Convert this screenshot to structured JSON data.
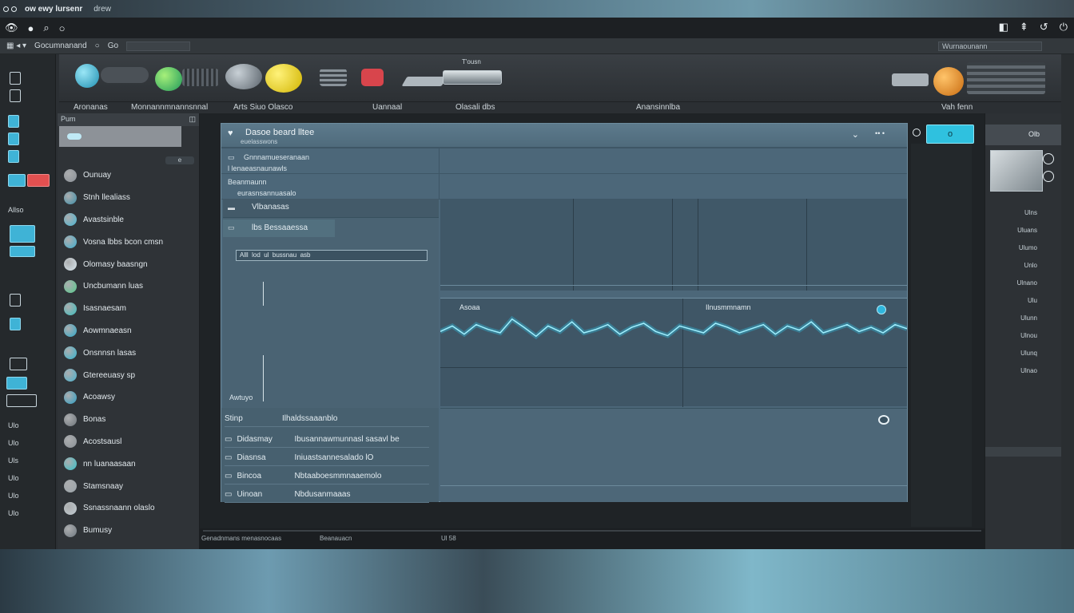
{
  "window": {
    "title": "ow ewy lursenr",
    "subtitle": "drew"
  },
  "iconbar": {
    "left_icons": [
      "eye-icon",
      "dot-icon",
      "search-icon",
      "circle-icon"
    ],
    "right_icons": [
      "lock-icon",
      "arrow-icon",
      "undo-icon",
      "power-icon"
    ]
  },
  "menu": {
    "items": [
      "Gocumnanand",
      "Go"
    ],
    "right_field": "Wurnaounann"
  },
  "ribbon_labels": [
    "Aronanas",
    "Monnannmnannsnnal",
    "Arts Siuo Olasco",
    "Uannaal",
    "Olasali dbs",
    "Anansinnlba",
    "Vah fenn"
  ],
  "ribbon": {
    "top_label": "T'ousn"
  },
  "leftstrip": {
    "labels": [
      "Allso",
      "Ulo",
      "Ulo",
      "Uls",
      "Ulo",
      "Ulo",
      "Ulo"
    ]
  },
  "layers": {
    "header": "Pum",
    "tab": "e",
    "items": [
      {
        "label": "Ounuay",
        "color": "#8a9097"
      },
      {
        "label": "Stnh llealiass",
        "color": "#3e8ea8"
      },
      {
        "label": "Avastsinble",
        "color": "#49b5d3"
      },
      {
        "label": "Vosna lbbs bcon cmsn",
        "color": "#3faed0"
      },
      {
        "label": "Olomasy baasngn",
        "color": "#d9e7ee"
      },
      {
        "label": "Uncbumann luas",
        "color": "#57c98c"
      },
      {
        "label": "Isasnaesam",
        "color": "#3dbdbd"
      },
      {
        "label": "Aowmnaeasn",
        "color": "#2fa9c9"
      },
      {
        "label": "Onsnnsn lasas",
        "color": "#35b4cf"
      },
      {
        "label": "Gtereeuasy sp",
        "color": "#4bb2cf"
      },
      {
        "label": "Acoawsy",
        "color": "#2f9ec3"
      },
      {
        "label": "Bonas",
        "color": "#6d747a"
      },
      {
        "label": "Acostsausl",
        "color": "#8a9096"
      },
      {
        "label": "nn luanaasaan",
        "color": "#38c0c8"
      },
      {
        "label": "Stamsnaay",
        "color": "#9aa3a9"
      },
      {
        "label": "Ssnassnaann olaslo",
        "color": "#c0cbd1"
      },
      {
        "label": "Bumusy",
        "color": "#6f7880"
      }
    ]
  },
  "canvas": {
    "header_title": "Dasoe beard lltee",
    "header_sub": "euelasswons",
    "row1_left": "Gnnnamueseranaan",
    "row1_sub": "l lenaeasnaunawls",
    "row2_left": "Beanmaunn",
    "row2_sub": "eurasnsannuasalo",
    "track_labels": [
      "Vlbanasas",
      "lbs Bessaaessa"
    ],
    "scrubber": "Alll  lod  ul  bussnau  asb",
    "side_caption": "Awtuyo",
    "wave_left": "Asoaa",
    "wave_right": "Ilnusmmnamn",
    "props_header_k": "Stinp",
    "props_header_v": "Ilhaldssaaanblo",
    "props": [
      {
        "k": "Didasmay",
        "v": "Ibusannawmunnasl sasavl be"
      },
      {
        "k": "Diasnsa",
        "v": "Iniuastsannesalado lO"
      },
      {
        "k": "Bincoa",
        "v": "Nbtaaboesmmnaaemolo"
      },
      {
        "k": "Uinoan",
        "v": "Nbdusanmaaas"
      }
    ],
    "action_button": "o"
  },
  "rightpanel": {
    "top_label": "Olb",
    "list": [
      "Ulns",
      "Uluans",
      "Ulumo",
      "Unlo",
      "Ulnano",
      "Ulu",
      "Ulunn",
      "Ulnou",
      "Ulunq",
      "Ulnao"
    ]
  },
  "status": {
    "left": "Genadnmans menasnocaas",
    "mid": "Beanauacn",
    "right": "Ul 58"
  },
  "wave_series": [
    0.52,
    0.6,
    0.48,
    0.62,
    0.55,
    0.5,
    0.7,
    0.58,
    0.45,
    0.6,
    0.52,
    0.66,
    0.5,
    0.55,
    0.62,
    0.48,
    0.58,
    0.64,
    0.52,
    0.46,
    0.6,
    0.55,
    0.5,
    0.64,
    0.58,
    0.5,
    0.56,
    0.62,
    0.48,
    0.6,
    0.54,
    0.66,
    0.5,
    0.56,
    0.62,
    0.52,
    0.58,
    0.5,
    0.62,
    0.56
  ]
}
